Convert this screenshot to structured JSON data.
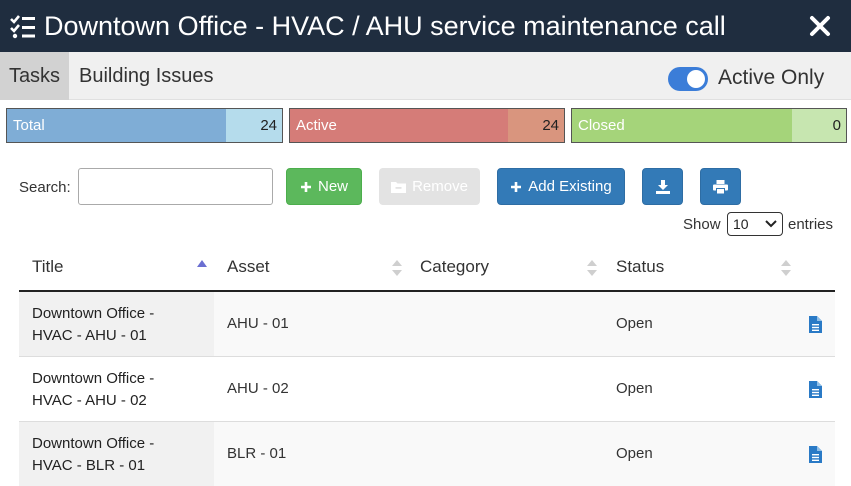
{
  "window": {
    "title": "Downtown Office - HVAC / AHU service maintenance call"
  },
  "tabs": [
    {
      "label": "Tasks",
      "active": true
    },
    {
      "label": "Building Issues",
      "active": false
    }
  ],
  "toggle": {
    "label": "Active Only",
    "on": true
  },
  "stats": {
    "total": {
      "label": "Total",
      "count": "24"
    },
    "active": {
      "label": "Active",
      "count": "24"
    },
    "closed": {
      "label": "Closed",
      "count": "0"
    }
  },
  "search": {
    "label": "Search:",
    "value": ""
  },
  "buttons": {
    "new": "New",
    "remove": "Remove",
    "add_existing": "Add Existing"
  },
  "paging": {
    "show": "Show",
    "entries_value": "10",
    "entries": "entries"
  },
  "table": {
    "columns": [
      "Title",
      "Asset",
      "Category",
      "Status"
    ],
    "rows": [
      {
        "title_l1": "Downtown Office -",
        "title_l2": "HVAC - AHU - 01",
        "asset": "AHU - 01",
        "category": "",
        "status": "Open"
      },
      {
        "title_l1": "Downtown Office -",
        "title_l2": "HVAC - AHU - 02",
        "asset": "AHU - 02",
        "category": "",
        "status": "Open"
      },
      {
        "title_l1": "Downtown Office -",
        "title_l2": "HVAC - BLR - 01",
        "asset": "BLR - 01",
        "category": "",
        "status": "Open"
      }
    ]
  },
  "icons": {
    "header": "task-list-icon",
    "close": "close-icon",
    "row_action": "document-icon"
  },
  "colors": {
    "titlebar": "#1f2d3f",
    "toggle": "#3b7dd8",
    "total": "#7fadd6",
    "active": "#d57c78",
    "closed": "#a5d47a",
    "primary": "#337ab7",
    "success": "#5cb85c"
  }
}
